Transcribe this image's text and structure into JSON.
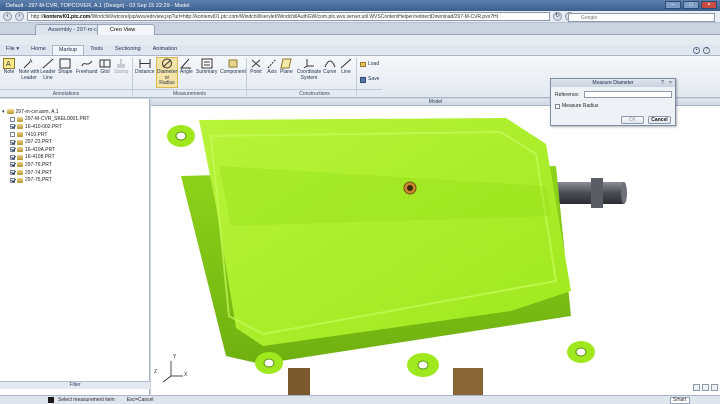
{
  "browser": {
    "title": "Default - 297-M-CVR, TOPCOVER, A.1 (Design) - 03 Sep 15 22:29 - Model",
    "url_prefix": "http://",
    "url_host": "kontenvl01.ptc.com",
    "url_rest": "/Windchill/wtcore/jsp/wvs/edrview.jsp?url=http://kontenvl01.ptc.com/Windchill/servlet/WindchillAuthGW/com.ptc.wvs.server.util.WVSContentHelper/redirectDownload/297-M-CVR.pvs?Ht",
    "search_placeholder": "Google",
    "tabs": [
      {
        "label": "Assembly - 297-m-c..."
      },
      {
        "label": "Creo View"
      }
    ]
  },
  "ribbon": {
    "file_label": "File",
    "tabs": [
      "Home",
      "Markup",
      "Tools",
      "Sectioning",
      "Animation"
    ],
    "active_tab": "Markup",
    "annotations_group": "Annotations",
    "measurements_group": "Measurements",
    "constructions_group": "Constructions",
    "buttons": {
      "note": "Note",
      "note_with_leader": "Note with Leader",
      "leader_line": "Leader Line",
      "shape": "Shape",
      "freehand": "Freehand",
      "gtol": "Gtol",
      "stamp": "Stamp",
      "distance": "Distance",
      "diameter": "Diameter or Radius",
      "angle": "Angle",
      "summary": "Summary",
      "component": "Component",
      "point": "Point",
      "axis": "Axis",
      "plane": "Plane",
      "coord_system": "Coordinate System",
      "curve": "Curve",
      "line": "Line",
      "load": "Load",
      "save": "Save"
    }
  },
  "tree": {
    "root": "297-m-cvr.asm, A.1",
    "items": [
      {
        "label": "297-M-CVR_SKEL0001.PRT",
        "checked": false
      },
      {
        "label": "16-410-002.PRT",
        "checked": true
      },
      {
        "label": "7410.PRT",
        "checked": false
      },
      {
        "label": "297-23.PRT",
        "checked": true
      },
      {
        "label": "16-410A.PRT",
        "checked": true
      },
      {
        "label": "16-4108.PRT",
        "checked": true
      },
      {
        "label": "297-76.PRT",
        "checked": true
      },
      {
        "label": "297-74.PRT",
        "checked": true
      },
      {
        "label": "297-75.PRT",
        "checked": true
      }
    ],
    "filter_label": "Filter"
  },
  "model": {
    "header": "Model",
    "part_color": "#a8f020",
    "axis_labels": {
      "x": "X",
      "y": "Y",
      "z": "Z"
    }
  },
  "dialog": {
    "title": "Measure Diameter",
    "reference_label": "Reference:",
    "reference_value": "",
    "measure_radius_label": "Measure Radius",
    "measure_radius_checked": false,
    "ok_label": "OK",
    "cancel_label": "Cancel"
  },
  "status": {
    "message": "Select measurement item",
    "hint": "Esc=Cancel",
    "mode": "Smart"
  }
}
